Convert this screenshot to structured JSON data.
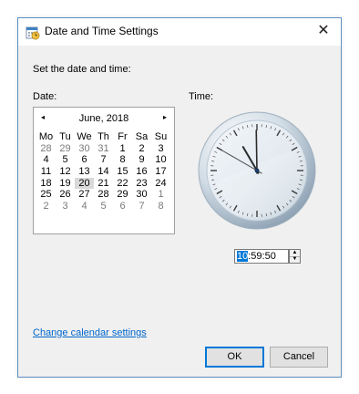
{
  "window": {
    "title": "Date and Time Settings",
    "close_glyph": "✕",
    "icon": "calendar-clock-icon"
  },
  "labels": {
    "instruction": "Set the date and time:",
    "date": "Date:",
    "time": "Time:"
  },
  "calendar": {
    "month_title": "June, 2018",
    "prev_glyph": "◂",
    "next_glyph": "▸",
    "weekdays": [
      "Mo",
      "Tu",
      "We",
      "Th",
      "Fr",
      "Sa",
      "Su"
    ],
    "weeks": [
      [
        "28",
        "29",
        "30",
        "31",
        "1",
        "2",
        "3"
      ],
      [
        "4",
        "5",
        "6",
        "7",
        "8",
        "9",
        "10"
      ],
      [
        "11",
        "12",
        "13",
        "14",
        "15",
        "16",
        "17"
      ],
      [
        "18",
        "19",
        "20",
        "21",
        "22",
        "23",
        "24"
      ],
      [
        "25",
        "26",
        "27",
        "28",
        "29",
        "30",
        "1"
      ],
      [
        "2",
        "3",
        "4",
        "5",
        "6",
        "7",
        "8"
      ]
    ],
    "selected": "20"
  },
  "clock": {
    "hour": 10,
    "minute": 59,
    "second": 50
  },
  "time_field": {
    "hour": "10",
    "rest": ":59:50",
    "spin_up_glyph": "▲",
    "spin_down_glyph": "▼"
  },
  "link": "Change calendar settings",
  "buttons": {
    "ok": "OK",
    "cancel": "Cancel"
  },
  "colors": {
    "accent": "#0078d7",
    "link": "#0066cc",
    "selected_day": "#d9d9d9"
  }
}
